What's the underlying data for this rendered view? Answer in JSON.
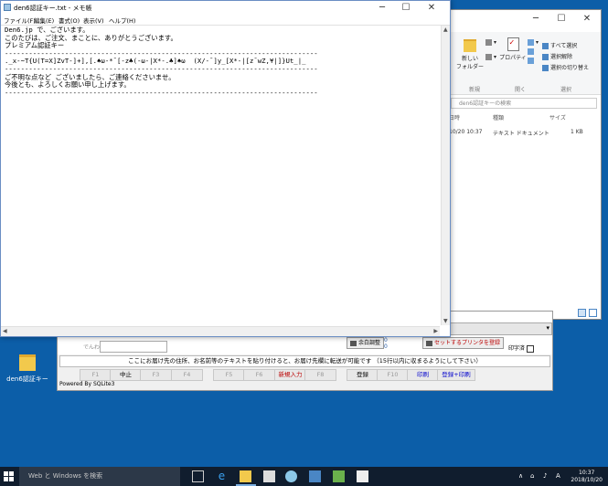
{
  "desktop": {
    "icon_label": "den6認証キー"
  },
  "notepad": {
    "title": "den6認証キー.txt - メモ帳",
    "menu": [
      "ファイル(F)",
      "編集(E)",
      "書式(O)",
      "表示(V)",
      "ヘルプ(H)"
    ],
    "lines": [
      "Den6.jp で、ございます。",
      "",
      "このたびは、ご注文、まことに、ありがとうございます。",
      "プレミアム認証キー",
      "------------------------------------------------------------------------------",
      "._x-~T{U(T=X]ZvT-]+],[.♠ω-*¯[-z♣(-ω-|X*-.♣]♠ω  (X/-¯]y_[X*-|[z¯wZ,¥|]}Ut_|_",
      "------------------------------------------------------------------------------",
      "ご不明な点など ございましたら、ご連絡くださいませ。",
      "今後とも、よろしくお願い申し上げます。",
      "------------------------------------------------------------------------------"
    ]
  },
  "explorer": {
    "ribbon": {
      "new_folder": "新しい\nフォルダー",
      "new_group": "新規",
      "properties": "プロパティ",
      "open_group": "開く",
      "select_all": "すべて選択",
      "select_none": "選択解除",
      "invert_selection": "選択の切り替え",
      "select_group": "選択"
    },
    "search_placeholder": "den6認証キーの検索",
    "columns": {
      "date": "日時",
      "type": "種類",
      "size": "サイズ"
    },
    "row": {
      "date": "10/20 10:37",
      "type": "テキスト ドキュメント",
      "size": "1 KB"
    }
  },
  "app": {
    "label_dennwa": "でんわ",
    "margin_button": "余白調整",
    "margin_values": [
      "0",
      "0"
    ],
    "printer_button": "セットするプリンタを登録",
    "printed_label": "印字済",
    "note": "ここにお届け先の住所、お名前等のテキストを貼り付けると、お届け先欄に転送が可能です （15行以内に収まるようにして下さい）",
    "fkeys": [
      "F1",
      "中止",
      "F3",
      "F4",
      "F5",
      "F6",
      "新規入力",
      "F8",
      "登録",
      "F10",
      "印刷",
      "登録+印刷"
    ],
    "powered": "Powered By SQLite3"
  },
  "taskbar": {
    "search_placeholder": "Web と Windows を検索",
    "time": "10:37",
    "date": "2018/10/20",
    "ime": "A"
  },
  "colors": {
    "desktop": "#0c5ea8",
    "taskbar": "#101d2e",
    "accent": "#7aaee0"
  }
}
